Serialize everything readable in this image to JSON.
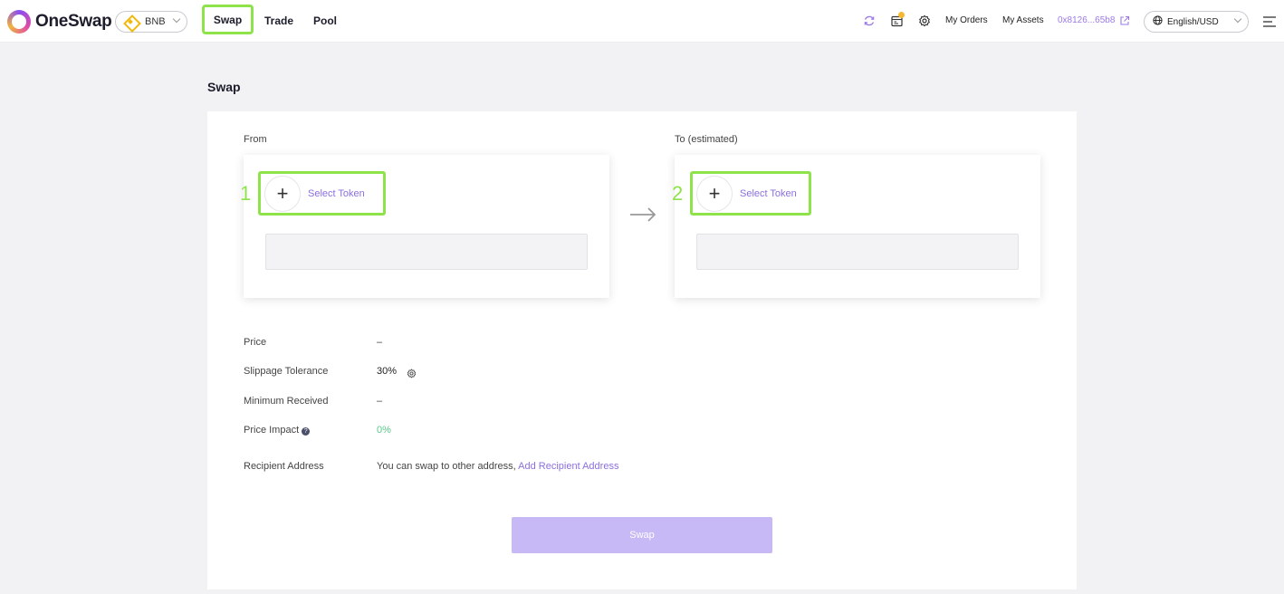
{
  "app": {
    "name": "OneSwap"
  },
  "header": {
    "chain": "BNB",
    "nav": {
      "swap": "Swap",
      "trade": "Trade",
      "pool": "Pool"
    },
    "links": {
      "my_orders": "My Orders",
      "my_assets": "My Assets",
      "wallet": "0x8126...65b8"
    },
    "language": "English/USD"
  },
  "page": {
    "title": "Swap"
  },
  "from": {
    "label": "From",
    "step": "1",
    "select_label": "Select Token"
  },
  "to": {
    "label": "To (estimated)",
    "step": "2",
    "select_label": "Select Token"
  },
  "details": {
    "price_label": "Price",
    "price_value": "–",
    "slippage_label": "Slippage Tolerance",
    "slippage_value": "30%",
    "min_received_label": "Minimum Received",
    "min_received_value": "–",
    "impact_label": "Price Impact",
    "impact_value": "0%",
    "recipient_label": "Recipient Address",
    "recipient_text": "You can swap to other address,",
    "recipient_link": "Add Recipient Address"
  },
  "swap_button": "Swap",
  "colors": {
    "accent": "#8b6fe0",
    "highlight": "#8ee34a",
    "positive": "#5ac88a",
    "button_disabled": "#c7b8f6"
  }
}
